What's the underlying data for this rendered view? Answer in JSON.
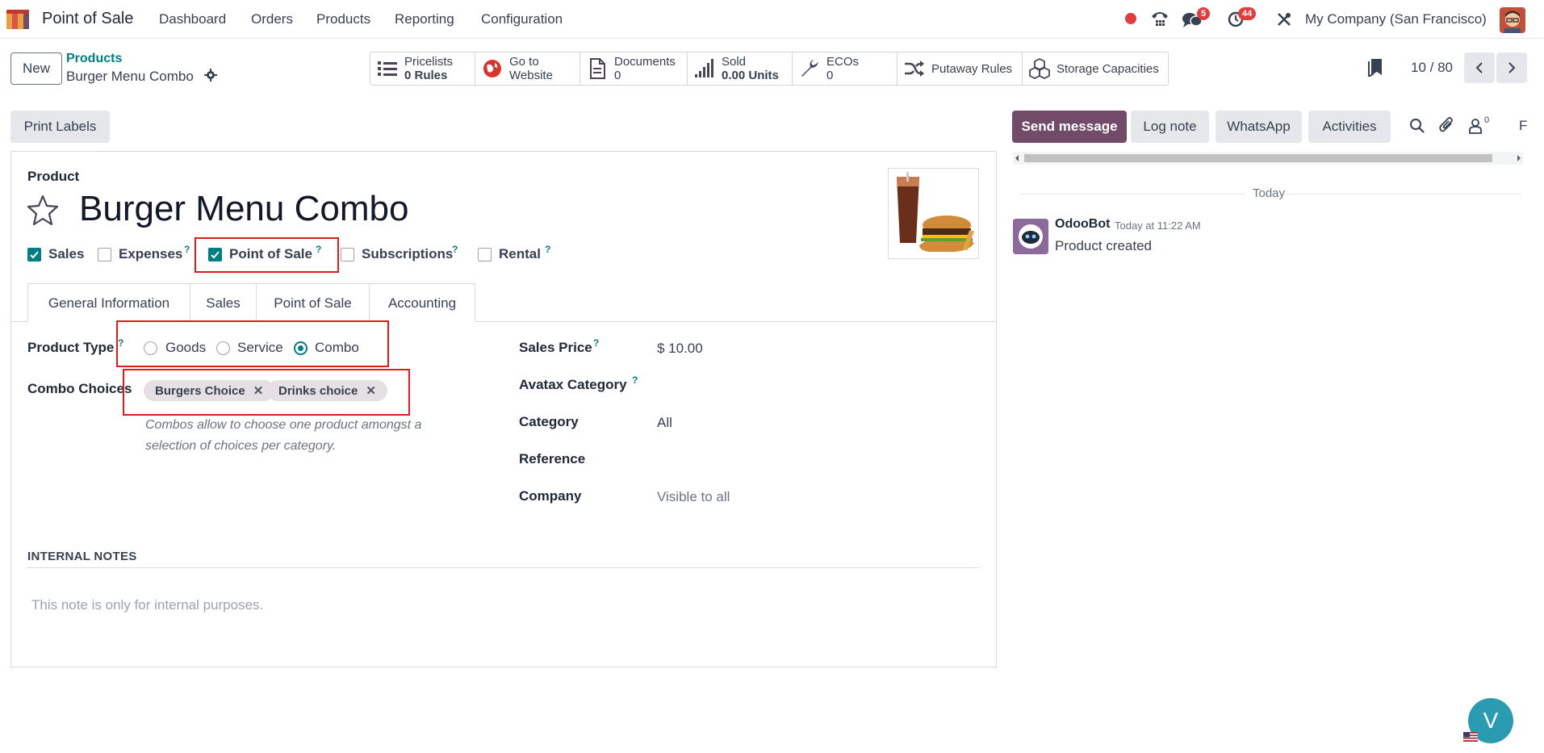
{
  "app": {
    "name": "Point of Sale",
    "menu": [
      "Dashboard",
      "Orders",
      "Products",
      "Reporting",
      "Configuration"
    ],
    "company": "My Company (San Francisco)",
    "badges": {
      "messages": "5",
      "activities": "44"
    }
  },
  "control_panel": {
    "new_label": "New",
    "breadcrumb": "Products",
    "record_name": "Burger Menu Combo",
    "pager": "10 / 80",
    "smart_buttons": [
      {
        "title": "Pricelists",
        "value": "0",
        "unit": "Rules",
        "icon": "list-icon"
      },
      {
        "title": "Go to",
        "value": "Website",
        "unit": "",
        "icon": "globe-icon"
      },
      {
        "title": "Documents",
        "value": "0",
        "unit": "",
        "icon": "file-icon"
      },
      {
        "title": "Sold",
        "value": "0.00",
        "unit": "Units",
        "icon": "signal-icon"
      },
      {
        "title": "ECOs",
        "value": "0",
        "unit": "",
        "icon": "wrench-icon"
      },
      {
        "title": "Putaway Rules",
        "value": "",
        "unit": "",
        "icon": "random-icon"
      },
      {
        "title": "Storage Capacities",
        "value": "",
        "unit": "",
        "icon": "cubes-icon"
      }
    ]
  },
  "form": {
    "print_labels": "Print Labels",
    "product_label": "Product",
    "product_name": "Burger Menu Combo",
    "options": [
      {
        "label": "Sales",
        "checked": true,
        "help": false
      },
      {
        "label": "Expenses",
        "checked": false,
        "help": true
      },
      {
        "label": "Point of Sale",
        "checked": true,
        "help": true
      },
      {
        "label": "Subscriptions",
        "checked": false,
        "help": true
      },
      {
        "label": "Rental",
        "checked": false,
        "help": true
      }
    ],
    "tabs": [
      "General Information",
      "Sales",
      "Point of Sale",
      "Accounting"
    ],
    "active_tab": "General Information",
    "product_type_label": "Product Type",
    "product_types": [
      "Goods",
      "Service",
      "Combo"
    ],
    "selected_product_type": "Combo",
    "combo_choices_label": "Combo Choices",
    "combo_choices": [
      "Burgers Choice",
      "Drinks choice"
    ],
    "combo_help": "Combos allow to choose one product amongst a selection of choices per category.",
    "right_fields": {
      "sales_price_label": "Sales Price",
      "sales_price": "$ 10.00",
      "avatax_label": "Avatax Category",
      "category_label": "Category",
      "category": "All",
      "reference_label": "Reference",
      "company_label": "Company",
      "company_placeholder": "Visible to all"
    },
    "internal_notes_label": "INTERNAL NOTES",
    "internal_notes_placeholder": "This note is only for internal purposes."
  },
  "chatter": {
    "send_message": "Send message",
    "log_note": "Log note",
    "whatsapp": "WhatsApp",
    "activities": "Activities",
    "followers_count": "0",
    "follow_label": "F",
    "date_separator": "Today",
    "messages": [
      {
        "author": "OdooBot",
        "time": "Today at 11:22 AM",
        "body": "Product created"
      }
    ]
  },
  "user_initial": "V",
  "colors": {
    "brand": "#714b67",
    "accent": "#017e84",
    "highlight": "#e01b1b",
    "badge": "#e23d3d"
  }
}
